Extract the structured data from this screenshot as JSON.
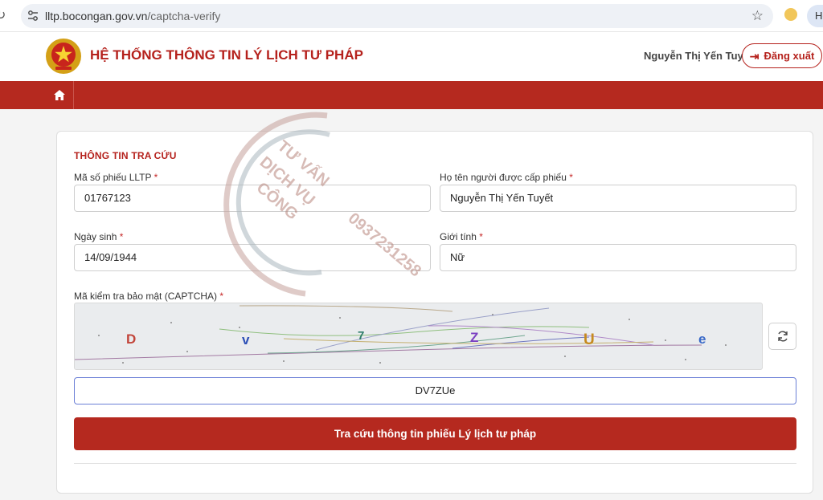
{
  "browser": {
    "url_host": "lltp.bocongan.gov.vn",
    "url_path": "/captcha-verify",
    "profile_label": "Ho"
  },
  "header": {
    "title": "HỆ THỐNG THÔNG TIN LÝ LỊCH TƯ PHÁP",
    "user_name": "Nguyễn Thị Yến Tuyết",
    "logout_label": "Đăng xuất"
  },
  "form": {
    "section_title": "THÔNG TIN TRA CỨU",
    "fields": {
      "ticket_code": {
        "label": "Mã số phiếu LLTP",
        "value": "01767123"
      },
      "full_name": {
        "label": "Họ tên người được cấp phiếu",
        "value": "Nguyễn Thị Yến Tuyết"
      },
      "dob": {
        "label": "Ngày sinh",
        "value": "14/09/1944"
      },
      "gender": {
        "label": "Giới tính",
        "value": "Nữ"
      },
      "captcha": {
        "label": "Mã kiểm tra bảo mật (CAPTCHA)",
        "value": "DV7ZUe"
      }
    },
    "required_mark": "*",
    "captcha_chars": [
      {
        "char": "D",
        "color": "#c2453a"
      },
      {
        "char": "v",
        "color": "#2c4fb6"
      },
      {
        "char": "7",
        "color": "#2e7d6b"
      },
      {
        "char": "Z",
        "color": "#7b3fc2"
      },
      {
        "char": "U",
        "color": "#c68a1e"
      },
      {
        "char": "e",
        "color": "#3a6ac8"
      }
    ],
    "submit_label": "Tra cứu thông tin phiếu Lý lịch tư pháp"
  },
  "watermark": {
    "line1": "TƯ VẤN",
    "line2": "DỊCH VỤ",
    "line3": "CÔNG",
    "phone": "0937231258"
  },
  "colors": {
    "brand_red": "#b5291f",
    "title_red": "#b5211c",
    "focus_blue": "#6b7fd6"
  }
}
